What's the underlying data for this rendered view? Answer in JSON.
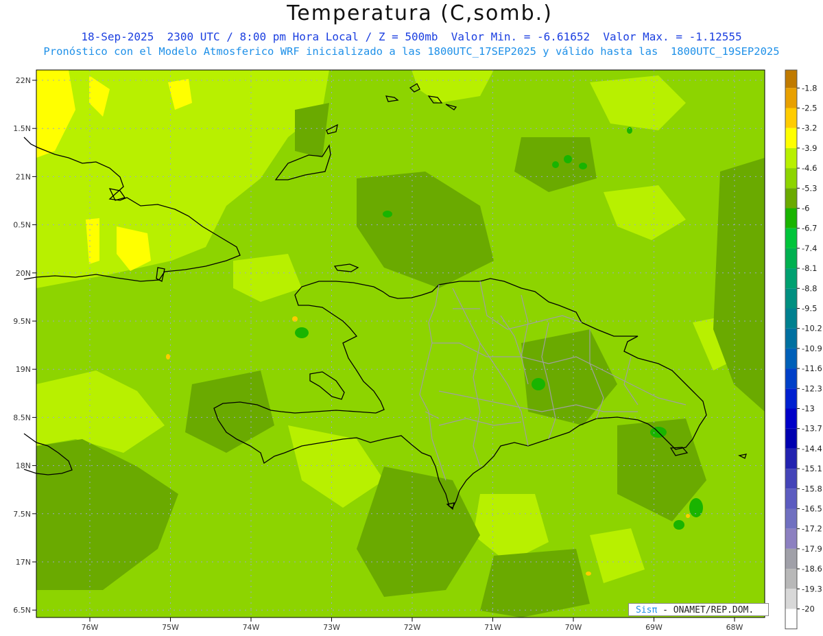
{
  "header": {
    "title": "Temperatura (C,somb.)",
    "line1": "18-Sep-2025  2300 UTC / 8:00 pm Hora Local / Z = 500mb  Valor Min. = -6.61652  Valor Max. = -1.12555",
    "line2": "Pronóstico con el Modelo Atmosferico WRF inicializado a las 1800UTC_17SEP2025 y válido hasta las  1800UTC_19SEP2025"
  },
  "map": {
    "lat_labels": [
      "22N",
      "1.5N",
      "21N",
      "0.5N",
      "20N",
      "9.5N",
      "19N",
      "8.5N",
      "18N",
      "7.5N",
      "17N",
      "6.5N"
    ],
    "lon_labels": [
      "76W",
      "75W",
      "74W",
      "73W",
      "72W",
      "71W",
      "70W",
      "69W",
      "68W"
    ],
    "background_color": "#8dd400"
  },
  "legend": {
    "levels": [
      {
        "label": "-1.8",
        "color": "#c07a00"
      },
      {
        "label": "-2.5",
        "color": "#e8a000"
      },
      {
        "label": "-3.2",
        "color": "#ffcc00"
      },
      {
        "label": "-3.9",
        "color": "#ffff00"
      },
      {
        "label": "-4.6",
        "color": "#b8f000"
      },
      {
        "label": "-5.3",
        "color": "#8dd400"
      },
      {
        "label": "-6",
        "color": "#6aaa00"
      },
      {
        "label": "-6.7",
        "color": "#19b400"
      },
      {
        "label": "-7.4",
        "color": "#00c43a"
      },
      {
        "label": "-8.1",
        "color": "#00b050"
      },
      {
        "label": "-8.8",
        "color": "#00a070"
      },
      {
        "label": "-9.5",
        "color": "#008f80"
      },
      {
        "label": "-10.2",
        "color": "#00808f"
      },
      {
        "label": "-10.9",
        "color": "#0070a0"
      },
      {
        "label": "-11.6",
        "color": "#0060b8"
      },
      {
        "label": "-12.3",
        "color": "#0040c8"
      },
      {
        "label": "-13",
        "color": "#0020d0"
      },
      {
        "label": "-13.7",
        "color": "#0000c8"
      },
      {
        "label": "-14.4",
        "color": "#0000b0"
      },
      {
        "label": "-15.1",
        "color": "#2222b0"
      },
      {
        "label": "-15.8",
        "color": "#4444b8"
      },
      {
        "label": "-16.5",
        "color": "#5c5cc0"
      },
      {
        "label": "-17.2",
        "color": "#7070c0"
      },
      {
        "label": "-17.9",
        "color": "#8c80c0"
      },
      {
        "label": "-18.6",
        "color": "#a0a0a8"
      },
      {
        "label": "-19.3",
        "color": "#b8b8b8"
      },
      {
        "label": "-20",
        "color": "#d8d8d8"
      }
    ],
    "bottom_color": "#ffffff"
  },
  "credit": {
    "sis": "Sisπ",
    "text": " - ONAMET/REP.DOM."
  }
}
